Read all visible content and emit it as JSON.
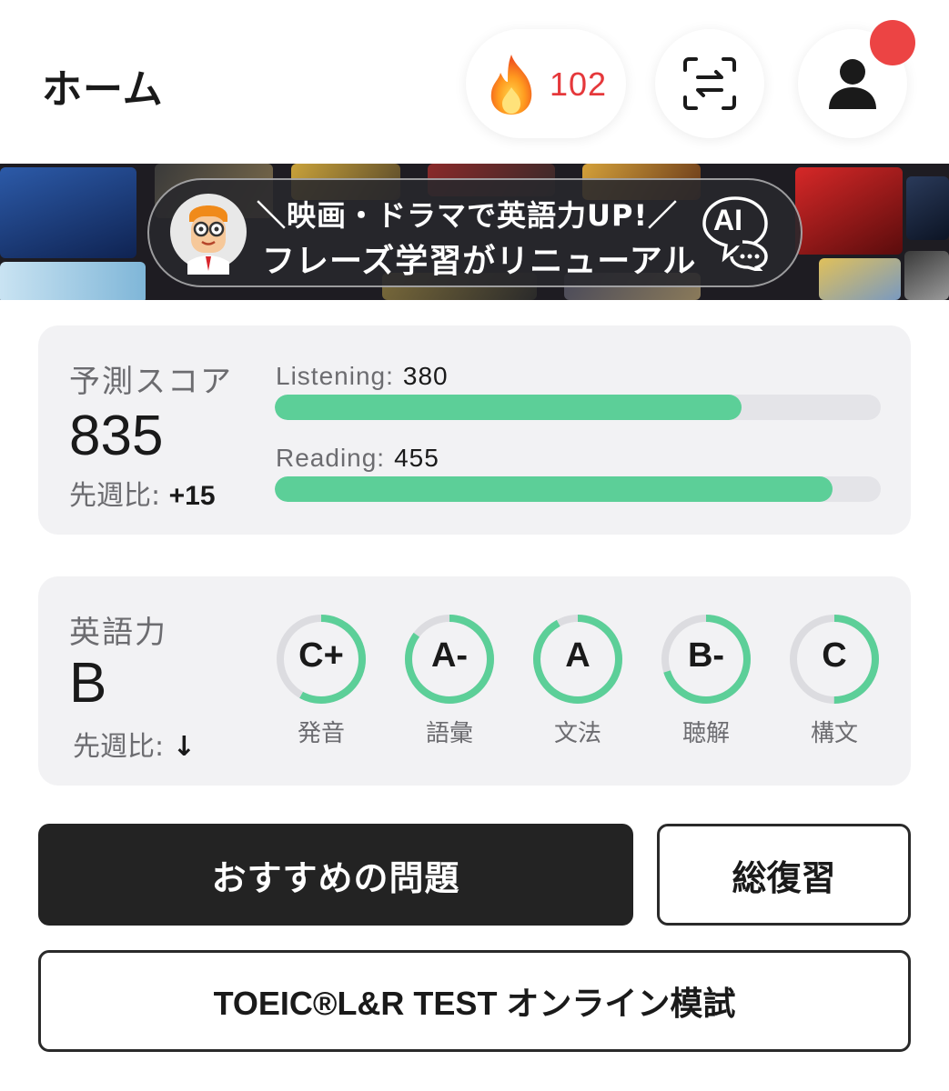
{
  "header": {
    "title": "ホーム",
    "streak_count": "102"
  },
  "banner": {
    "line1": "＼映画・ドラマで英語力UP!／",
    "line2": "フレーズ学習がリニューアル",
    "ai_label": "AI"
  },
  "score": {
    "label": "予測スコア",
    "value": "835",
    "delta_label": "先週比:",
    "delta_value": "+15",
    "listening": {
      "label": "Listening:",
      "value": "380",
      "fraction": 0.77
    },
    "reading": {
      "label": "Reading:",
      "value": "455",
      "fraction": 0.92
    }
  },
  "skills": {
    "label": "英語力",
    "grade": "B",
    "delta_label": "先週比:",
    "delta_arrow": "↓",
    "items": [
      {
        "grade": "C+",
        "name": "発音",
        "fraction": 0.58
      },
      {
        "grade": "A-",
        "name": "語彙",
        "fraction": 0.85
      },
      {
        "grade": "A",
        "name": "文法",
        "fraction": 0.92
      },
      {
        "grade": "B-",
        "name": "聴解",
        "fraction": 0.7
      },
      {
        "grade": "C",
        "name": "構文",
        "fraction": 0.5
      }
    ]
  },
  "colors": {
    "accent_green": "#5ccf98",
    "streak_red": "#e5383b",
    "notification_red": "#ec4444",
    "card_bg": "#f2f2f4"
  },
  "buttons": {
    "recommended": "おすすめの問題",
    "review": "総復習",
    "mock_test": "TOEIC®L&R TEST オンライン模試"
  },
  "icons": {
    "streak": "flame-icon",
    "translate": "translate-icon",
    "profile": "user-icon",
    "mascot": "mascot-icon",
    "ai_chat": "ai-chat-icon"
  }
}
